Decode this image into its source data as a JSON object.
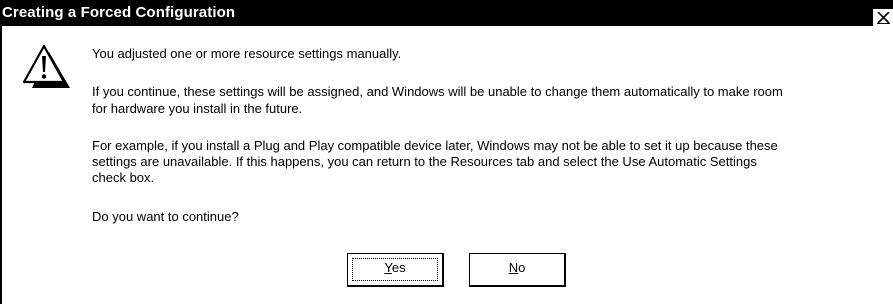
{
  "dialog": {
    "title": "Creating a Forced Configuration",
    "close_label": "X"
  },
  "message": {
    "line1": "You adjusted one or more resource settings manually.",
    "line2a": "If you continue, these settings will be assigned, and Windows will be unable to change them automatically to make room",
    "line2b": "for hardware you install in the future.",
    "line3a": "For example, if you install a Plug and Play compatible device later,  Windows may not be able to set it up because these",
    "line3b": "settings are unavailable. If this happens, you can return to the Resources tab and select the Use Automatic Settings",
    "line3c": "check box.",
    "line4": "Do you want to continue?"
  },
  "buttons": {
    "yes_mnemonic": "Y",
    "yes_rest": "es",
    "no_mnemonic": "N",
    "no_rest": "o"
  },
  "icons": {
    "warning": "exclamation-warning-icon",
    "close": "close-icon"
  },
  "colors": {
    "titlebar": "#000000",
    "background": "#ffffff",
    "text": "#000000"
  }
}
